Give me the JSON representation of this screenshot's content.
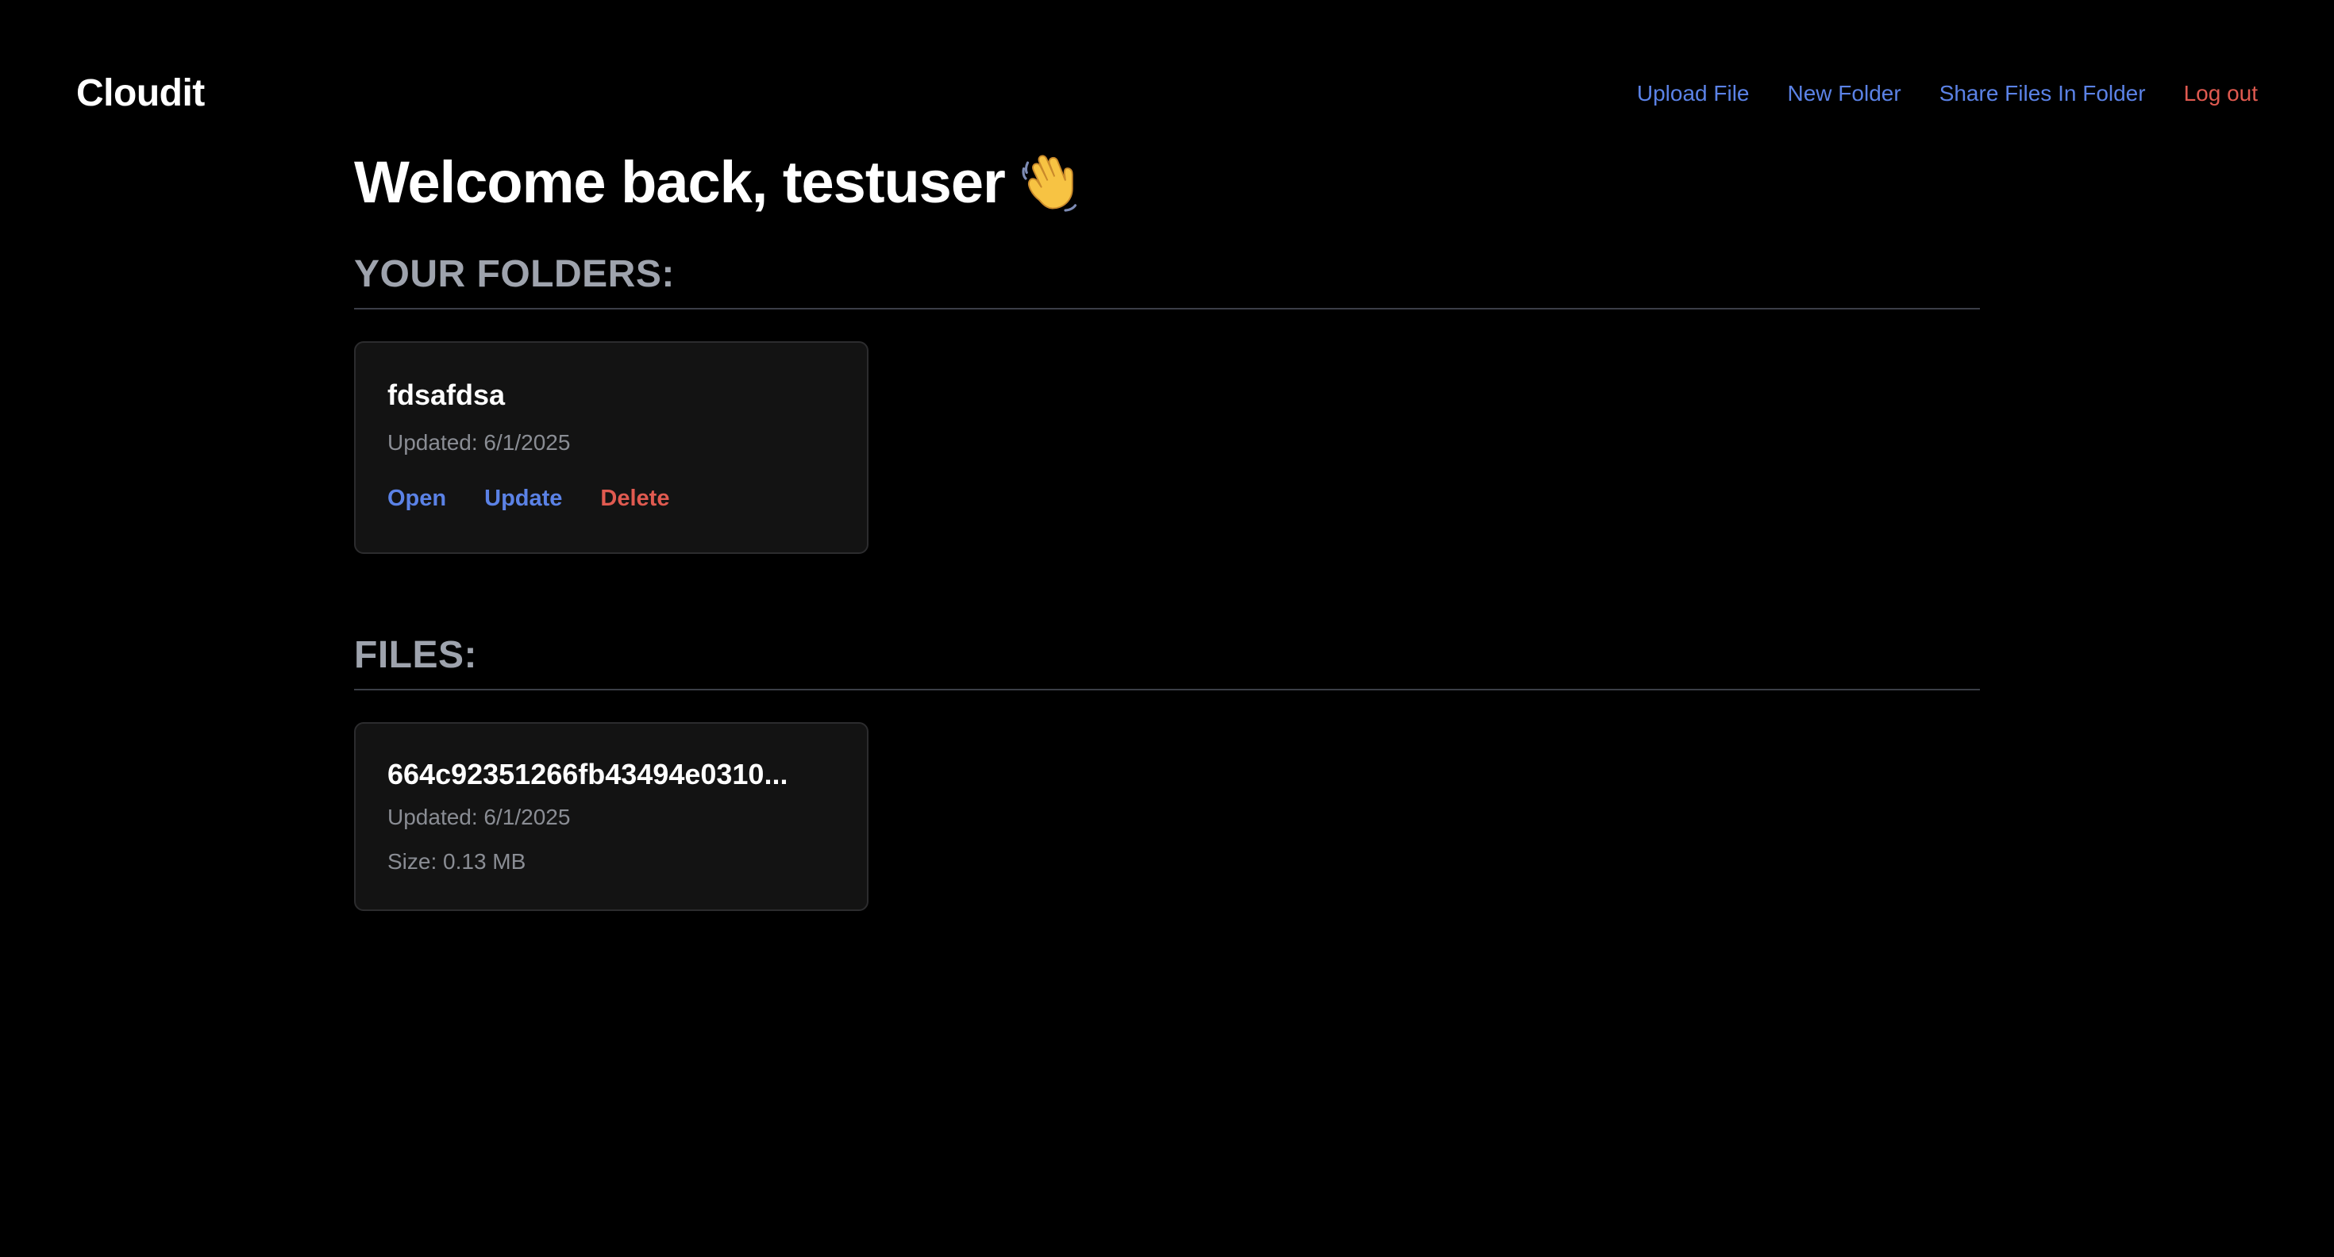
{
  "app": {
    "brand": "Cloudit"
  },
  "nav": {
    "upload_file": "Upload File",
    "new_folder": "New Folder",
    "share_files": "Share Files In Folder",
    "log_out": "Log out"
  },
  "welcome": {
    "text": "Welcome back, testuser",
    "icon": "waving-hand-icon"
  },
  "folders_section": {
    "title": "YOUR FOLDERS:",
    "items": [
      {
        "name": "fdsafdsa",
        "updated": "Updated: 6/1/2025",
        "actions": {
          "open": "Open",
          "update": "Update",
          "delete": "Delete"
        }
      }
    ]
  },
  "files_section": {
    "title": "FILES:",
    "items": [
      {
        "name": "664c92351266fb43494e0310...",
        "updated": "Updated: 6/1/2025",
        "size": "Size: 0.13 MB"
      }
    ]
  },
  "colors": {
    "background": "#000000",
    "link": "#5b82e6",
    "danger": "#e05a50",
    "muted": "#8a8d94",
    "card": "#131313"
  }
}
